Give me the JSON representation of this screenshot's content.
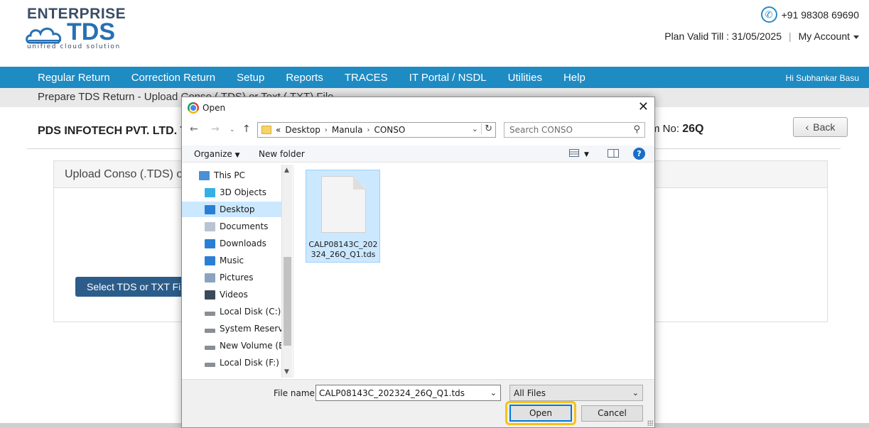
{
  "brand": {
    "line1": "ENTERPRISE",
    "line2": "TDS",
    "tagline": "unified cloud solution",
    "accent": "#1e8bc3"
  },
  "contact": {
    "phone": "+91 98308 69690",
    "plan_valid": "Plan Valid Till : 31/05/2025",
    "separator": "|",
    "my_account": "My Account"
  },
  "nav": {
    "items": [
      "Regular Return",
      "Correction Return",
      "Setup",
      "Reports",
      "TRACES",
      "IT Portal / NSDL",
      "Utilities",
      "Help"
    ],
    "greeting": "Hi Subhankar Basu"
  },
  "breadcrumb": "Prepare TDS Return - Upload Conso ( TDS) or Text ( TXT) File",
  "page": {
    "company": "PDS INFOTECH PVT. LTD. T",
    "form_label": "m No: ",
    "form_value": "26Q",
    "back_label": "Back",
    "panel_title": "Upload Conso (.TDS) o",
    "select_button": "Select TDS or TXT File"
  },
  "dialog": {
    "title": "Open",
    "close": "✕",
    "address": {
      "prefix": "«",
      "segments": [
        "Desktop",
        "Manula",
        "CONSO"
      ]
    },
    "search_placeholder": "Search CONSO",
    "organize": "Organize",
    "new_folder": "New folder",
    "help": "?",
    "tree": [
      {
        "label": "This PC",
        "icon": "pc-icon",
        "color": "#4a8fd8",
        "indent": 0,
        "selected": false
      },
      {
        "label": "3D Objects",
        "icon": "cube-icon",
        "color": "#35b0e6",
        "indent": 1,
        "selected": false
      },
      {
        "label": "Desktop",
        "icon": "desktop-icon",
        "color": "#2a7fd4",
        "indent": 1,
        "selected": true
      },
      {
        "label": "Documents",
        "icon": "documents-icon",
        "color": "#b8c4d0",
        "indent": 1,
        "selected": false
      },
      {
        "label": "Downloads",
        "icon": "downloads-icon",
        "color": "#2a7fd4",
        "indent": 1,
        "selected": false
      },
      {
        "label": "Music",
        "icon": "music-icon",
        "color": "#2a7fd4",
        "indent": 1,
        "selected": false
      },
      {
        "label": "Pictures",
        "icon": "pictures-icon",
        "color": "#8aa4c0",
        "indent": 1,
        "selected": false
      },
      {
        "label": "Videos",
        "icon": "videos-icon",
        "color": "#3a4a5a",
        "indent": 1,
        "selected": false
      },
      {
        "label": "Local Disk (C:)",
        "icon": "drive-icon",
        "color": "#8a8f96",
        "indent": 1,
        "selected": false
      },
      {
        "label": "System Reservec",
        "icon": "drive-icon",
        "color": "#8a8f96",
        "indent": 1,
        "selected": false
      },
      {
        "label": "New Volume (E:)",
        "icon": "drive-icon",
        "color": "#8a8f96",
        "indent": 1,
        "selected": false
      },
      {
        "label": "Local Disk (F:)",
        "icon": "drive-icon",
        "color": "#8a8f96",
        "indent": 1,
        "selected": false
      }
    ],
    "file": {
      "name": "CALP08143C_202324_26Q_Q1.tds"
    },
    "file_name_label": "File name:",
    "file_name_value": "CALP08143C_202324_26Q_Q1.tds",
    "file_type": "All Files",
    "open_label": "Open",
    "cancel_label": "Cancel"
  }
}
